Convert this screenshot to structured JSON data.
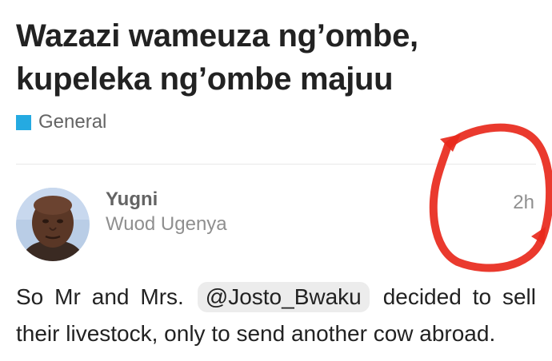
{
  "topic": {
    "title": "Wazazi wameuza ng’ombe, kupeleka ng’ombe majuu",
    "category": {
      "label": "General",
      "color": "#25aae1"
    }
  },
  "post": {
    "author": {
      "name": "Yugni",
      "title": "Wuod Ugenya"
    },
    "time": "2h",
    "body": {
      "before_mention": "So Mr and Mrs.",
      "mention": "@Josto_Bwaku",
      "after_mention": "decided to sell their livestock, only to send another cow abroad."
    }
  },
  "colors": {
    "text": "#222222",
    "muted": "#8f8f8f",
    "annotation": "#e8291c"
  }
}
